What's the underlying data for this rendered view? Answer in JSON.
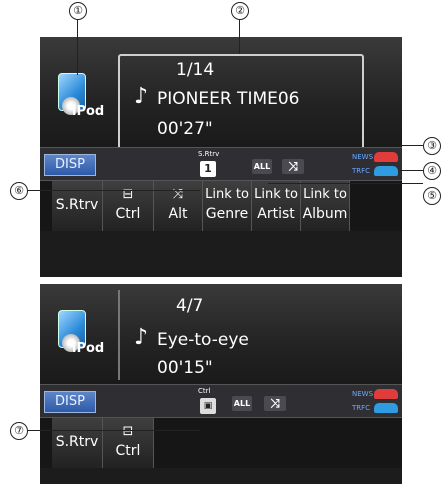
{
  "callouts": [
    "①",
    "②",
    "③",
    "④",
    "⑤",
    "⑥",
    "⑦"
  ],
  "screen1": {
    "ipod_label": "iPod",
    "track_count": "1/14",
    "song_title": "PIONEER TIME06",
    "time": "00'27\"",
    "note_icon": "♪",
    "disp": "DISP",
    "srtv_label": "S.Rtrv",
    "srtv_value": "1",
    "repeat_label": "ALL",
    "shuffle_icon": "⤨",
    "news_label": "NEWS",
    "trfc_label": "TRFC",
    "buttons": [
      {
        "single": "S.Rtrv"
      },
      {
        "top": "⊟",
        "bottom": "Ctrl"
      },
      {
        "top": "⤨",
        "bottom": "Alt"
      },
      {
        "top": "Link to",
        "bottom": "Genre"
      },
      {
        "top": "Link to",
        "bottom": "Artist"
      },
      {
        "top": "Link to",
        "bottom": "Album"
      }
    ]
  },
  "screen2": {
    "ipod_label": "iPod",
    "track_count": "4/7",
    "song_title": "Eye-to-eye",
    "time": "00'15\"",
    "note_icon": "♪",
    "disp": "DISP",
    "ctrl_label": "Ctrl",
    "repeat_label": "ALL",
    "shuffle_icon": "⤨",
    "news_label": "NEWS",
    "trfc_label": "TRFC",
    "buttons": [
      {
        "single": "S.Rtrv"
      },
      {
        "top": "⊟",
        "bottom": "Ctrl"
      }
    ]
  }
}
